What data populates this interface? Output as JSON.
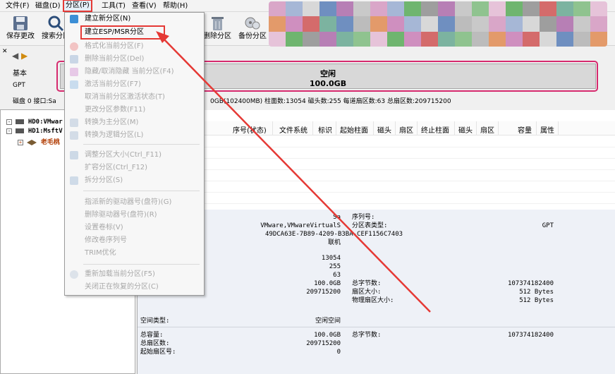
{
  "menubar": {
    "items": [
      "文件(F)",
      "磁盘(D)",
      "分区(P)",
      "工具(T)",
      "查看(V)",
      "帮助(H)"
    ]
  },
  "toolbar": {
    "buttons": [
      "保存更改",
      "搜索分区",
      "删除分区",
      "备份分区"
    ]
  },
  "left_nav": {
    "labels": [
      "基本",
      "GPT",
      "磁盘 0 接口:Sa"
    ]
  },
  "tree": {
    "items": [
      "HD0:VMwar",
      "HD1:MsftV",
      "老毛桃"
    ]
  },
  "disk_bar": {
    "label": "空闲",
    "size": "100.0GB"
  },
  "disk_info": {
    "text": "0GB(102400MB)  柱面数:13054  磁头数:255  每道扇区数:63  总扇区数:209715200"
  },
  "table": {
    "headers": [
      "序号(状态)",
      "文件系统",
      "标识",
      "起始柱面",
      "磁头",
      "扇区",
      "终止柱面",
      "磁头",
      "扇区",
      "容量",
      "属性"
    ]
  },
  "details": {
    "model_lines": [
      "Sa",
      "VMware,VMwareVirtualS",
      "49DCA63E-7B89-4209-B3BA-CEF1156C7403",
      "联机"
    ],
    "serial_label": "序列号:",
    "ptable_label": "分区表类型:",
    "ptable_value": "GPT",
    "geo_values": [
      "13054",
      "255",
      "63",
      "100.0GB",
      "209715200"
    ],
    "geo_labels": [
      "总字节数:",
      "扇区大小:",
      "物理扇区大小:"
    ],
    "geo_right_values": [
      "107374182400",
      "512 Bytes",
      "512 Bytes"
    ],
    "part_type_label": "空间类型:",
    "part_type_value": "空闲空间",
    "cap_labels": [
      "总容量:",
      "总扇区数:",
      "起始扇区号:"
    ],
    "cap_values": [
      "100.0GB",
      "209715200",
      "0"
    ],
    "total_bytes_label": "总字节数:",
    "total_bytes_value": "107374182400"
  },
  "dropdown": {
    "items": [
      {
        "label": "建立新分区(N)",
        "enabled": true
      },
      {
        "label": "建立ESP/MSR分区",
        "enabled": true
      },
      {
        "label": "格式化当前分区(F)",
        "enabled": false
      },
      {
        "label": "删除当前分区(Del)",
        "enabled": false
      },
      {
        "label": "隐藏/取消隐藏 当前分区(F4)",
        "enabled": false
      },
      {
        "label": "激活当前分区(F7)",
        "enabled": false
      },
      {
        "label": "取消当前分区激活状态(T)",
        "enabled": false
      },
      {
        "label": "更改分区参数(F11)",
        "enabled": false
      },
      {
        "label": "转换为主分区(M)",
        "enabled": false
      },
      {
        "label": "转换为逻辑分区(L)",
        "enabled": false
      },
      {
        "label": "调整分区大小(Ctrl_F11)",
        "enabled": false
      },
      {
        "label": "扩容分区(Ctrl_F12)",
        "enabled": false
      },
      {
        "label": "拆分分区(S)",
        "enabled": false
      },
      {
        "label": "指派新的驱动器号(盘符)(G)",
        "enabled": false
      },
      {
        "label": "删除驱动器号(盘符)(R)",
        "enabled": false
      },
      {
        "label": "设置卷标(V)",
        "enabled": false
      },
      {
        "label": "修改卷序列号",
        "enabled": false
      },
      {
        "label": "TRIM优化",
        "enabled": false
      },
      {
        "label": "重新加载当前分区(F5)",
        "enabled": false
      },
      {
        "label": "关闭正在恢复的分区(C)",
        "enabled": false
      }
    ]
  },
  "colors": {
    "highlight_red": "#e53935",
    "disk_frame": "#d62a6e"
  }
}
